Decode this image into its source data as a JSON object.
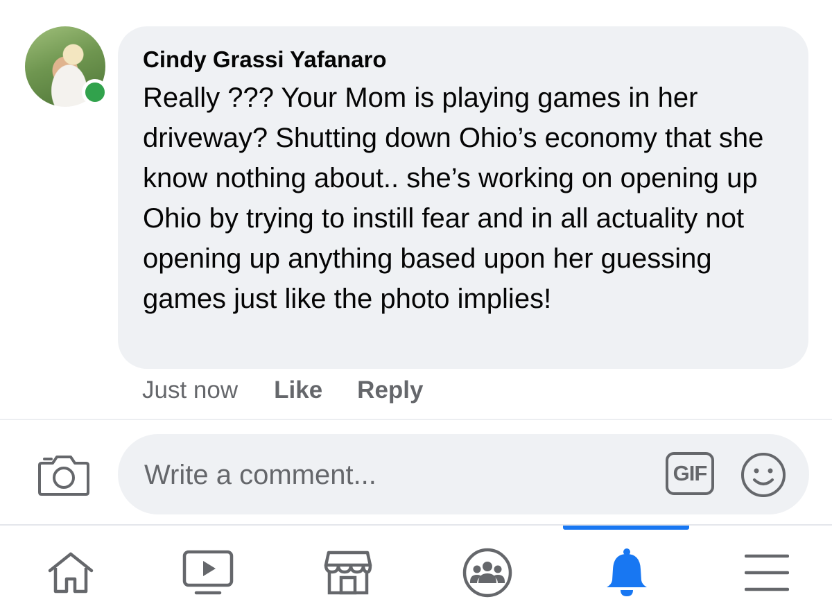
{
  "comment": {
    "author": "Cindy Grassi Yafanaro",
    "text": "Really ??? Your Mom is playing games in her driveway? Shutting down Ohio’s economy that she know nothing about.. she’s working on opening up Ohio by trying to instill fear and in all actuality not opening up anything based upon her guessing games just like the photo implies!",
    "online": true,
    "timestamp": "Just now",
    "like_label": "Like",
    "reply_label": "Reply"
  },
  "composer": {
    "placeholder": "Write a comment...",
    "gif_label": "GIF",
    "camera_icon": "camera-icon",
    "emoji_icon": "smile-icon"
  },
  "tabbar": {
    "items": [
      {
        "icon": "home-icon",
        "active": false
      },
      {
        "icon": "video-icon",
        "active": false
      },
      {
        "icon": "marketplace-icon",
        "active": false
      },
      {
        "icon": "groups-icon",
        "active": false
      },
      {
        "icon": "bell-icon",
        "active": true
      },
      {
        "icon": "menu-icon",
        "active": false
      }
    ]
  },
  "colors": {
    "accent": "#1877f2",
    "bubble": "#eff1f4",
    "secondary_text": "#65676b",
    "online": "#31a24c"
  }
}
